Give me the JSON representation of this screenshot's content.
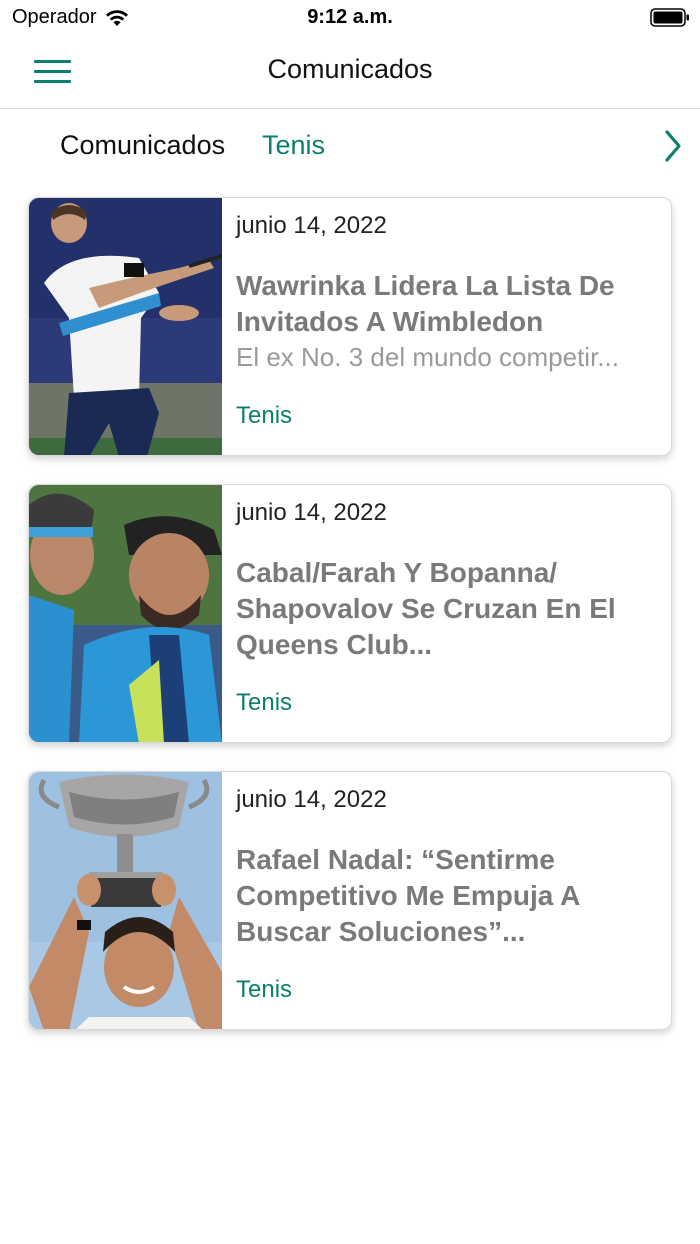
{
  "status_bar": {
    "carrier": "Operador",
    "time": "9:12 a.m."
  },
  "navbar": {
    "title": "Comunicados"
  },
  "tabs": [
    {
      "label": "Comunicados",
      "selected": true
    },
    {
      "label": "Tenis",
      "selected": false
    }
  ],
  "colors": {
    "accent": "#0a7f6e",
    "title_gray": "#7a7a7a"
  },
  "articles": [
    {
      "date": "junio 14, 2022",
      "title": "Wawrinka Lidera La Lista De Invitados A Wimbledon",
      "summary": "El ex No. 3 del mundo competir...",
      "category": "Tenis"
    },
    {
      "date": "junio 14, 2022",
      "title": "Cabal/Farah Y Bopanna/ Shapovalov Se Cruzan En El Queens Club...",
      "category": "Tenis"
    },
    {
      "date": "junio 14, 2022",
      "title": "Rafael Nadal: “Sentirme Competitivo Me Empuja A Buscar Soluciones”...",
      "category": "Tenis"
    }
  ]
}
